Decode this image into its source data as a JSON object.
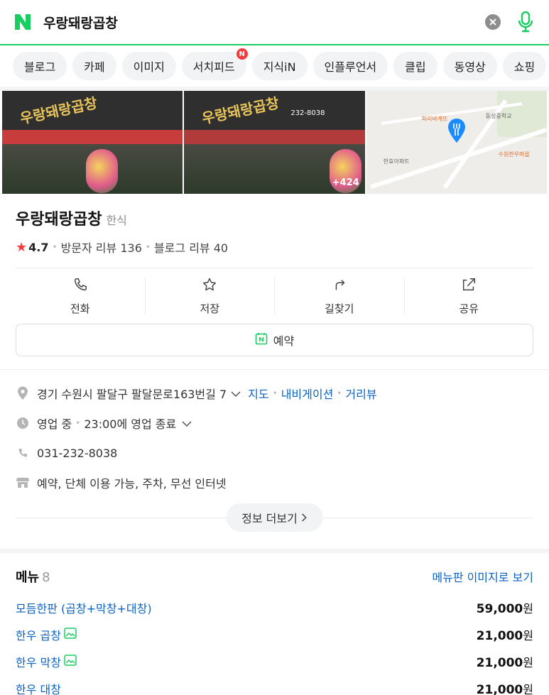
{
  "search": {
    "query": "우랑돼랑곱창"
  },
  "tabs": [
    {
      "label": "블로그"
    },
    {
      "label": "카페"
    },
    {
      "label": "이미지"
    },
    {
      "label": "서치피드",
      "badge": "N"
    },
    {
      "label": "지식iN"
    },
    {
      "label": "인플루언서"
    },
    {
      "label": "클립"
    },
    {
      "label": "동영상"
    },
    {
      "label": "쇼핑"
    }
  ],
  "photos": {
    "sign_text_1": "우랑돼랑곱창",
    "sign_text_2": "우랑돼랑곱창",
    "phone_plate": "232-8038",
    "more_count": "+424"
  },
  "map": {
    "labels": [
      "파리바게뜨",
      "동성중학교",
      "한효아파트",
      "수원한우마을"
    ]
  },
  "place": {
    "name": "우랑돼랑곱창",
    "category": "한식",
    "rating": "4.7",
    "visitor_reviews": "방문자 리뷰 136",
    "blog_reviews": "블로그 리뷰 40"
  },
  "actions": [
    {
      "label": "전화",
      "icon": "phone-icon"
    },
    {
      "label": "저장",
      "icon": "star-icon"
    },
    {
      "label": "길찾기",
      "icon": "directions-icon"
    },
    {
      "label": "공유",
      "icon": "share-icon"
    }
  ],
  "reserve": {
    "label": "예약"
  },
  "details": {
    "address": "경기 수원시 팔달구 팔달문로163번길 7",
    "map_link": "지도",
    "navi_link": "내비게이션",
    "street_link": "거리뷰",
    "status": "영업 중",
    "hours": "23:00에 영업 종료",
    "phone": "031-232-8038",
    "amenities": "예약, 단체 이용 가능, 주차, 무선 인터넷",
    "more_label": "정보 더보기"
  },
  "menu": {
    "title": "메뉴",
    "count": "8",
    "image_link": "메뉴판 이미지로 보기",
    "items": [
      {
        "name": "모듬한판 (곱창+막창+대창)",
        "price": "59,000",
        "unit": "원"
      },
      {
        "name": "한우 곱창",
        "price": "21,000",
        "unit": "원"
      },
      {
        "name": "한우 막창",
        "price": "21,000",
        "unit": "원"
      },
      {
        "name": "한우 대창",
        "price": "21,000",
        "unit": "원"
      }
    ]
  },
  "colors": {
    "brand": "#19ce60",
    "link": "#0b62c4",
    "star": "#f23b3b"
  }
}
